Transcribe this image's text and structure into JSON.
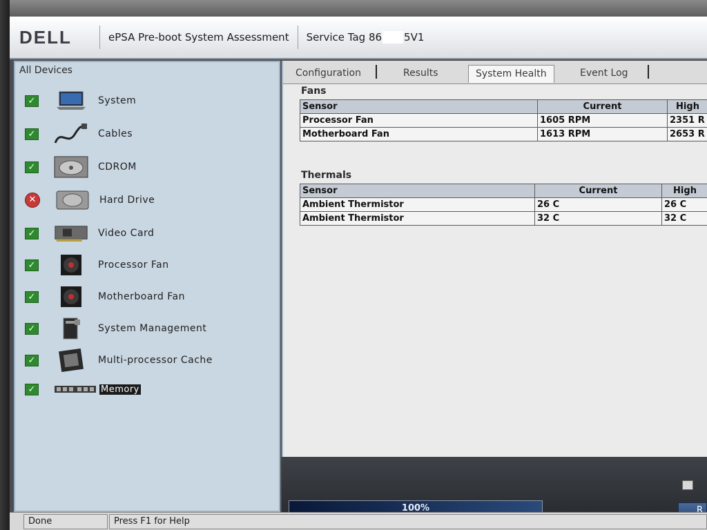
{
  "header": {
    "logo": "DELL",
    "title": "ePSA Pre-boot System Assessment",
    "service_tag_prefix": "Service Tag 86",
    "service_tag_suffix": "5V1"
  },
  "devices": {
    "title": "All Devices",
    "items": [
      {
        "label": "System",
        "status": "pass",
        "icon": "laptop-icon"
      },
      {
        "label": "Cables",
        "status": "pass",
        "icon": "cable-icon"
      },
      {
        "label": "CDROM",
        "status": "pass",
        "icon": "cdrom-icon"
      },
      {
        "label": "Hard Drive",
        "status": "fail",
        "icon": "hard-drive-icon"
      },
      {
        "label": "Video Card",
        "status": "pass",
        "icon": "video-card-icon"
      },
      {
        "label": "Processor Fan",
        "status": "pass",
        "icon": "fan-icon"
      },
      {
        "label": "Motherboard Fan",
        "status": "pass",
        "icon": "fan-icon"
      },
      {
        "label": "System Management",
        "status": "pass",
        "icon": "system-management-icon"
      },
      {
        "label": "Multi-processor Cache",
        "status": "pass",
        "icon": "cpu-icon"
      },
      {
        "label": "Memory",
        "status": "pass",
        "icon": "memory-icon"
      }
    ]
  },
  "tabs": [
    "Configuration",
    "Results",
    "System Health",
    "Event Log"
  ],
  "active_tab": "System Health",
  "fans": {
    "title": "Fans",
    "headers": [
      "Sensor",
      "Current",
      "High"
    ],
    "rows": [
      [
        "Processor Fan",
        "1605 RPM",
        "2351 R"
      ],
      [
        "Motherboard Fan",
        "1613 RPM",
        "2653 R"
      ]
    ]
  },
  "thermals": {
    "title": "Thermals",
    "headers": [
      "Sensor",
      "Current",
      "High"
    ],
    "rows": [
      [
        "Ambient Thermistor",
        "26 C",
        "26 C"
      ],
      [
        "Ambient Thermistor",
        "32 C",
        "32 C"
      ]
    ]
  },
  "progress": {
    "text": "100%",
    "value": 100
  },
  "bottom_button": "R",
  "status": {
    "left": "Done",
    "help": "Press F1 for Help"
  },
  "colors": {
    "pass": "#2f8a2f",
    "fail": "#c63a3a",
    "panel": "#c9d7e3"
  }
}
